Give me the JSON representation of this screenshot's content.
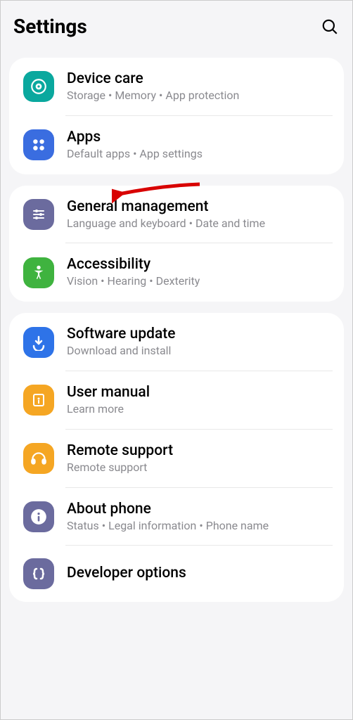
{
  "header": {
    "title": "Settings"
  },
  "groups": [
    {
      "items": [
        {
          "title": "Device care",
          "subtitle": "Storage  •  Memory  •  App protection"
        },
        {
          "title": "Apps",
          "subtitle": "Default apps  •  App settings"
        }
      ]
    },
    {
      "items": [
        {
          "title": "General management",
          "subtitle": "Language and keyboard  •  Date and time"
        },
        {
          "title": "Accessibility",
          "subtitle": "Vision  •  Hearing  •  Dexterity"
        }
      ]
    },
    {
      "items": [
        {
          "title": "Software update",
          "subtitle": "Download and install"
        },
        {
          "title": "User manual",
          "subtitle": "Learn more"
        },
        {
          "title": "Remote support",
          "subtitle": "Remote support"
        },
        {
          "title": "About phone",
          "subtitle": "Status  •  Legal information  •  Phone name"
        },
        {
          "title": "Developer options",
          "subtitle": ""
        }
      ]
    }
  ]
}
